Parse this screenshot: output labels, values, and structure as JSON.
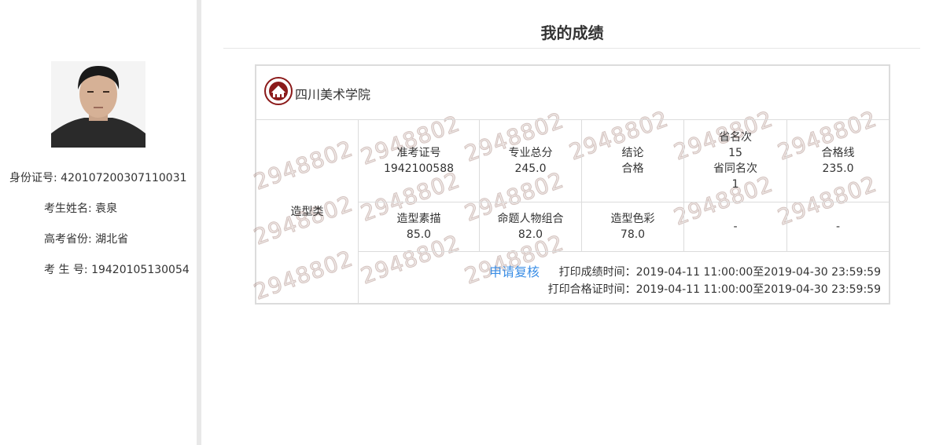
{
  "page": {
    "title": "我的成绩"
  },
  "profile": {
    "id_label": "身份证号:",
    "id_value": "420107200307110031",
    "name_label": "考生姓名:",
    "name_value": "袁泉",
    "province_label": "高考省份:",
    "province_value": "湖北省",
    "exam_no_label": "考 生 号:",
    "exam_no_value": "19420105130054"
  },
  "card": {
    "school_name": "四川美术学院",
    "category": "造型类",
    "row1": [
      {
        "label": "准考证号",
        "value": "1942100588"
      },
      {
        "label": "专业总分",
        "value": "245.0"
      },
      {
        "label": "结论",
        "value": "合格"
      },
      {
        "label": "省名次",
        "value": "15",
        "label2": "省同名次",
        "value2": "1"
      },
      {
        "label": "合格线",
        "value": "235.0"
      }
    ],
    "row2": [
      {
        "label": "造型素描",
        "value": "85.0"
      },
      {
        "label": "命题人物组合",
        "value": "82.0"
      },
      {
        "label": "造型色彩",
        "value": "78.0"
      },
      {
        "label": "",
        "value": "-"
      },
      {
        "label": "",
        "value": "-"
      }
    ],
    "review_link": "申请复核",
    "print_score_time": "打印成绩时间：2019-04-11 11:00:00至2019-04-30 23:59:59",
    "print_cert_time": "打印合格证时间：2019-04-11 11:00:00至2019-04-30 23:59:59",
    "watermark": "2948802"
  },
  "colors": {
    "link": "#3a8ee6",
    "logo": "#8b1a1a",
    "border": "#dcdcdc"
  }
}
